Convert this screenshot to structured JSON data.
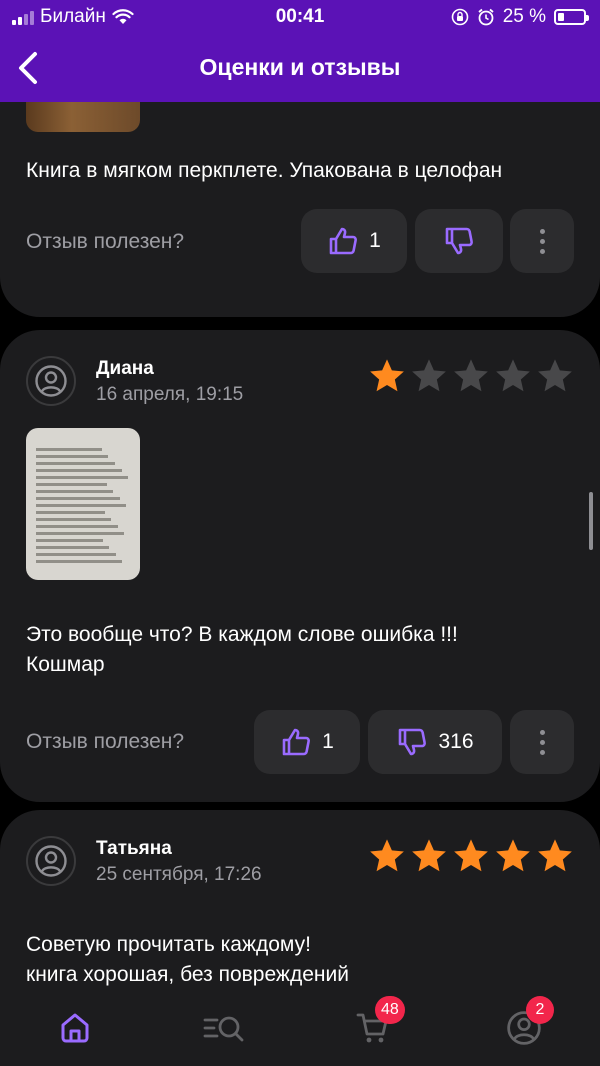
{
  "status_bar": {
    "carrier": "Билайн",
    "time": "00:41",
    "battery_percent": "25 %",
    "battery_level": 0.25
  },
  "nav": {
    "title": "Оценки и отзывы",
    "back_icon": "chevron-left-icon"
  },
  "colors": {
    "header_bg": "#5b12b6",
    "accent": "#9a6bff",
    "star_filled": "#ff8a1f",
    "star_empty": "#48484a",
    "badge": "#f2264b"
  },
  "reviews": [
    {
      "text": "Книга в мягком перкплете. Упакована в целофан",
      "helpful_label": "Отзыв полезен?",
      "likes": "1",
      "dislikes": ""
    },
    {
      "author": "Диана",
      "date": "16 апреля, 19:15",
      "rating": 1,
      "max_rating": 5,
      "text": "Это вообще что? В каждом слове ошибка !!!\nКошмар",
      "helpful_label": "Отзыв полезен?",
      "likes": "1",
      "dislikes": "316"
    },
    {
      "author": "Татьяна",
      "date": "25 сентября, 17:26",
      "rating": 5,
      "max_rating": 5,
      "text": "Советую прочитать каждому!\nкнига хорошая, без повреждений"
    }
  ],
  "tabbar": {
    "items": [
      {
        "icon": "home-icon",
        "active": true
      },
      {
        "icon": "catalog-search-icon",
        "active": false
      },
      {
        "icon": "cart-icon",
        "active": false,
        "badge": "48"
      },
      {
        "icon": "profile-icon",
        "active": false,
        "badge": "2"
      }
    ]
  }
}
